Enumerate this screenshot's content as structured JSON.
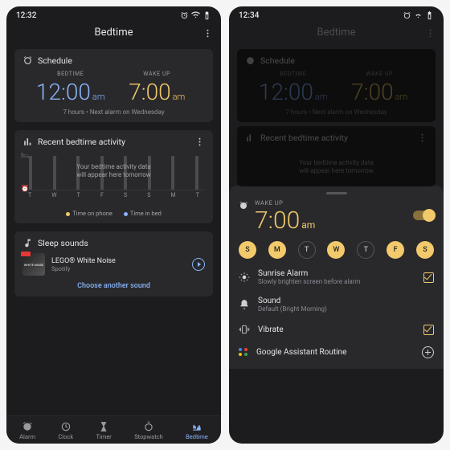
{
  "left": {
    "status_time": "12:32",
    "title": "Bedtime",
    "schedule": {
      "heading": "Schedule",
      "bedtime_label": "BEDTIME",
      "bedtime_value": "12:00",
      "bedtime_ampm": "am",
      "wake_label": "WAKE UP",
      "wake_value": "7:00",
      "wake_ampm": "am",
      "footer": "7 hours • Next alarm on Wednesday"
    },
    "activity": {
      "heading": "Recent bedtime activity",
      "message_l1": "Your bedtime activity data",
      "message_l2": "will appear here tomorrow",
      "days": [
        "T",
        "W",
        "T",
        "F",
        "S",
        "S",
        "M",
        "T"
      ],
      "legend_phone": "Time on phone",
      "legend_bed": "Time in bed"
    },
    "sounds": {
      "heading": "Sleep sounds",
      "track_name": "LEGO® White Noise",
      "track_source": "Spotify",
      "album_text": "WHITE NOISE",
      "choose": "Choose another sound"
    },
    "nav": {
      "alarm": "Alarm",
      "clock": "Clock",
      "timer": "Timer",
      "stopwatch": "Stopwatch",
      "bedtime": "Bedtime"
    }
  },
  "right": {
    "status_time": "12:34",
    "title": "Bedtime",
    "schedule": {
      "heading": "Schedule",
      "bedtime_label": "BEDTIME",
      "bedtime_value": "12:00",
      "bedtime_ampm": "am",
      "wake_label": "WAKE UP",
      "wake_value": "7:00",
      "wake_ampm": "am",
      "footer": "7 hours • Next alarm on Wednesday"
    },
    "activity": {
      "heading": "Recent bedtime activity",
      "message_l1": "Your bedtime activity data",
      "message_l2": "will appear here tomorrow"
    },
    "sheet": {
      "label": "WAKE UP",
      "time": "7:00",
      "ampm": "am",
      "days": [
        {
          "d": "S",
          "on": true
        },
        {
          "d": "M",
          "on": true
        },
        {
          "d": "T",
          "on": false
        },
        {
          "d": "W",
          "on": true
        },
        {
          "d": "T",
          "on": false
        },
        {
          "d": "F",
          "on": true
        },
        {
          "d": "S",
          "on": true
        }
      ],
      "sunrise_t": "Sunrise Alarm",
      "sunrise_s": "Slowly brighten screen before alarm",
      "sound_t": "Sound",
      "sound_s": "Default (Bright Morning)",
      "vibrate": "Vibrate",
      "routine": "Google Assistant Routine"
    }
  }
}
